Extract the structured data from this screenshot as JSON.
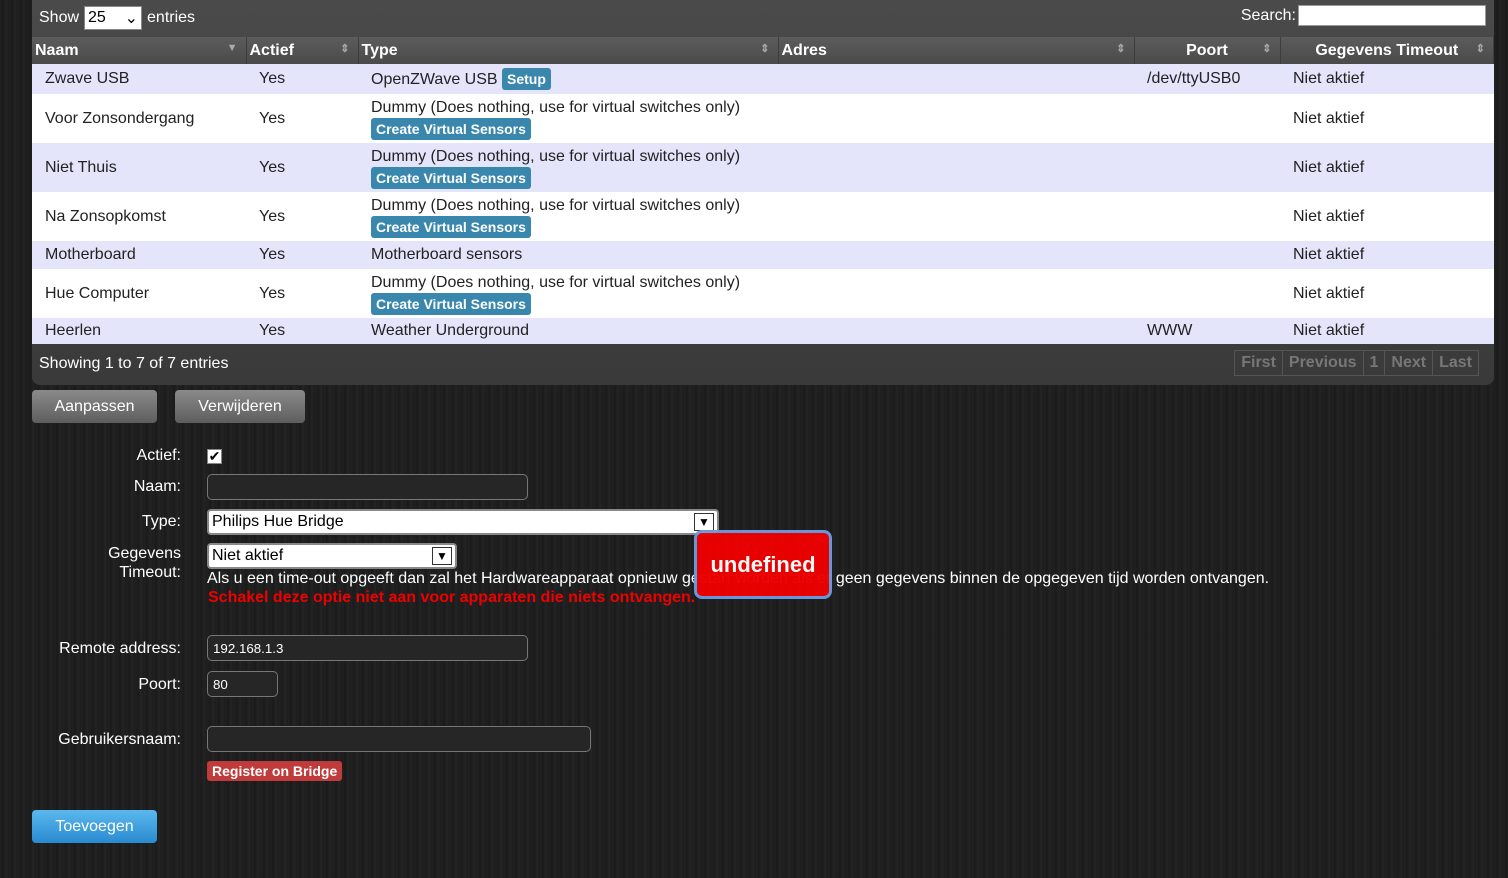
{
  "table": {
    "show_label": "Show",
    "page_size": "25",
    "entries_label": "entries",
    "search_label": "Search:",
    "search_value": "",
    "columns": [
      "Naam",
      "Actief",
      "Type",
      "Adres",
      "Poort",
      "Gegevens Timeout"
    ],
    "rows": [
      {
        "naam": "Zwave USB",
        "actief": "Yes",
        "type": "OpenZWave USB",
        "button": "Setup",
        "adres": "",
        "poort": "/dev/ttyUSB0",
        "timeout": "Niet aktief"
      },
      {
        "naam": "Voor Zonsondergang",
        "actief": "Yes",
        "type": "Dummy (Does nothing, use for virtual switches only)",
        "button": "Create Virtual Sensors",
        "adres": "",
        "poort": "",
        "timeout": "Niet aktief"
      },
      {
        "naam": "Niet Thuis",
        "actief": "Yes",
        "type": "Dummy (Does nothing, use for virtual switches only)",
        "button": "Create Virtual Sensors",
        "adres": "",
        "poort": "",
        "timeout": "Niet aktief"
      },
      {
        "naam": "Na Zonsopkomst",
        "actief": "Yes",
        "type": "Dummy (Does nothing, use for virtual switches only)",
        "button": "Create Virtual Sensors",
        "adres": "",
        "poort": "",
        "timeout": "Niet aktief"
      },
      {
        "naam": "Motherboard",
        "actief": "Yes",
        "type": "Motherboard sensors",
        "button": "",
        "adres": "",
        "poort": "",
        "timeout": "Niet aktief"
      },
      {
        "naam": "Hue Computer",
        "actief": "Yes",
        "type": "Dummy (Does nothing, use for virtual switches only)",
        "button": "Create Virtual Sensors",
        "adres": "",
        "poort": "",
        "timeout": "Niet aktief"
      },
      {
        "naam": "Heerlen",
        "actief": "Yes",
        "type": "Weather Underground",
        "button": "",
        "adres": "",
        "poort": "WWW",
        "timeout": "Niet aktief"
      }
    ],
    "info": "Showing 1 to 7 of 7 entries",
    "pager": [
      "First",
      "Previous",
      "1",
      "Next",
      "Last"
    ]
  },
  "actions": {
    "edit": "Aanpassen",
    "delete": "Verwijderen"
  },
  "form": {
    "actief_label": "Actief:",
    "actief_checked": true,
    "naam_label": "Naam:",
    "naam_value": "",
    "type_label": "Type:",
    "type_value": "Philips Hue Bridge",
    "timeout_label_1": "Gegevens",
    "timeout_label_2": "Timeout:",
    "timeout_value": "Niet aktief",
    "timeout_help": "Als u een time-out opgeeft dan zal het Hardwareapparaat opnieuw gestart worden als er geen gegevens binnen de opgegeven tijd worden ontvangen.",
    "timeout_warning": "Schakel deze optie niet aan voor apparaten die niets ontvangen.",
    "remote_label": "Remote address:",
    "remote_value": "192.168.1.3",
    "poort_label": "Poort:",
    "poort_value": "80",
    "user_label": "Gebruikersnaam:",
    "user_value": "",
    "register_button": "Register on Bridge",
    "add_button": "Toevoegen"
  },
  "tooltip": {
    "text": "undefined",
    "color": "#ee0000"
  }
}
